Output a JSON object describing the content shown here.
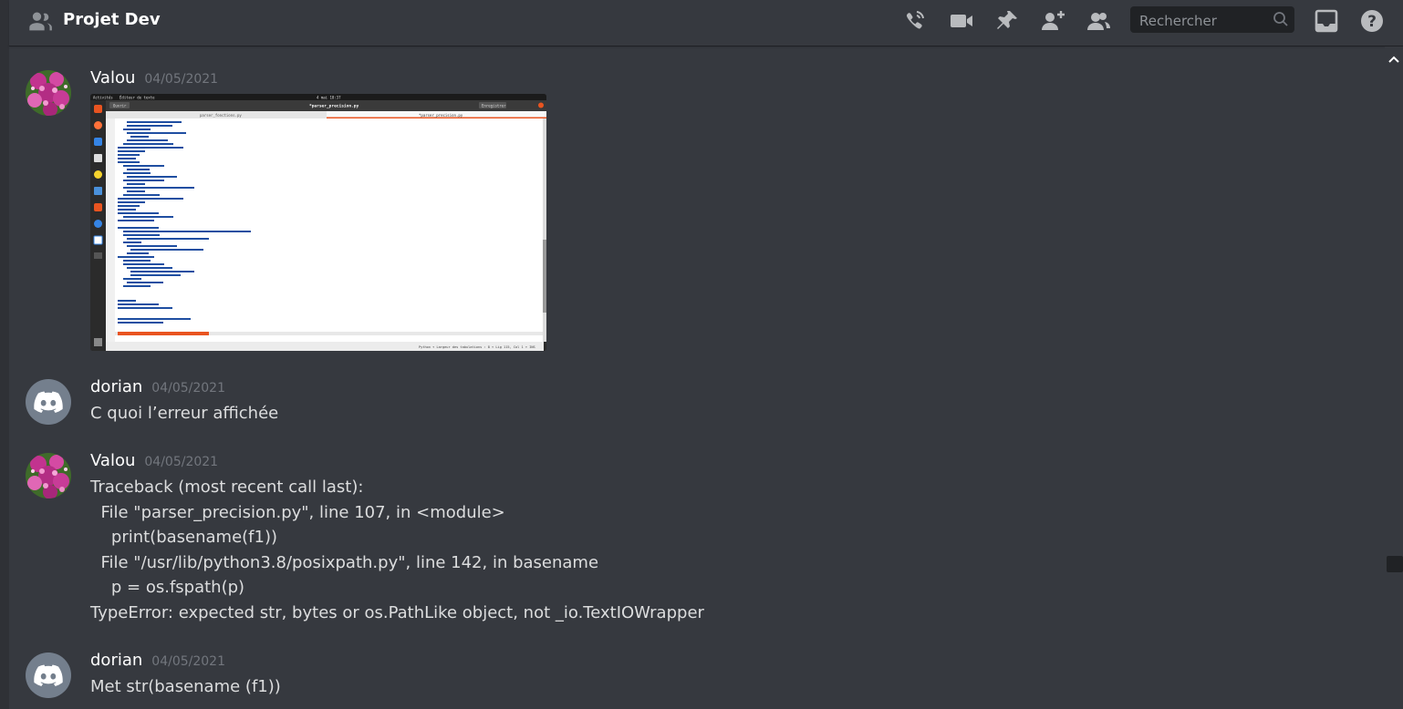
{
  "header": {
    "channel_name": "Projet Dev",
    "search_placeholder": "Rechercher"
  },
  "icons": {
    "header": [
      "people-icon",
      "phone-call-icon",
      "video-call-icon",
      "pin-icon",
      "add-friend-icon",
      "members-icon",
      "search-icon",
      "inbox-icon",
      "help-icon"
    ],
    "avatar_default": "discord-logo-icon"
  },
  "colors": {
    "background": "#36393f",
    "header_text": "#ffffff",
    "timestamp": "#72767d",
    "search_bg": "#202225",
    "default_avatar": "#747f8d"
  },
  "messages": [
    {
      "author": "Valou",
      "timestamp": "04/05/2021",
      "avatar": "flower-photo",
      "attachment": "screenshot of code editor: parser_precision.py"
    },
    {
      "author": "dorian",
      "timestamp": "04/05/2021",
      "avatar": "discord-default",
      "text": "C quoi l’erreur affichée"
    },
    {
      "author": "Valou",
      "timestamp": "04/05/2021",
      "avatar": "flower-photo",
      "lines": [
        "Traceback (most recent call last):",
        "  File \"parser_precision.py\", line 107, in <module>",
        "    print(basename(f1))",
        "  File \"/usr/lib/python3.8/posixpath.py\", line 142, in basename",
        "    p = os.fspath(p)",
        "TypeError: expected str, bytes or os.PathLike object, not _io.TextIOWrapper"
      ]
    },
    {
      "author": "dorian",
      "timestamp": "04/05/2021",
      "avatar": "discord-default",
      "text": "Met str(basename (f1))"
    }
  ],
  "attachment_screenshot": {
    "topbar_left": "Activités",
    "topbar_app": "Éditeur de texte",
    "topbar_clock": "4 mai 10:37",
    "window_title": "*parser_precision.py",
    "open_button": "Ouvrir",
    "save_button": "Enregistrer",
    "tabs": [
      "parser_fonctions.py",
      "*parser_precision.py"
    ],
    "status": "Python ▾   Largeur des tabulations : 8 ▾   Lig 115, Col 1 ▾   INS"
  }
}
